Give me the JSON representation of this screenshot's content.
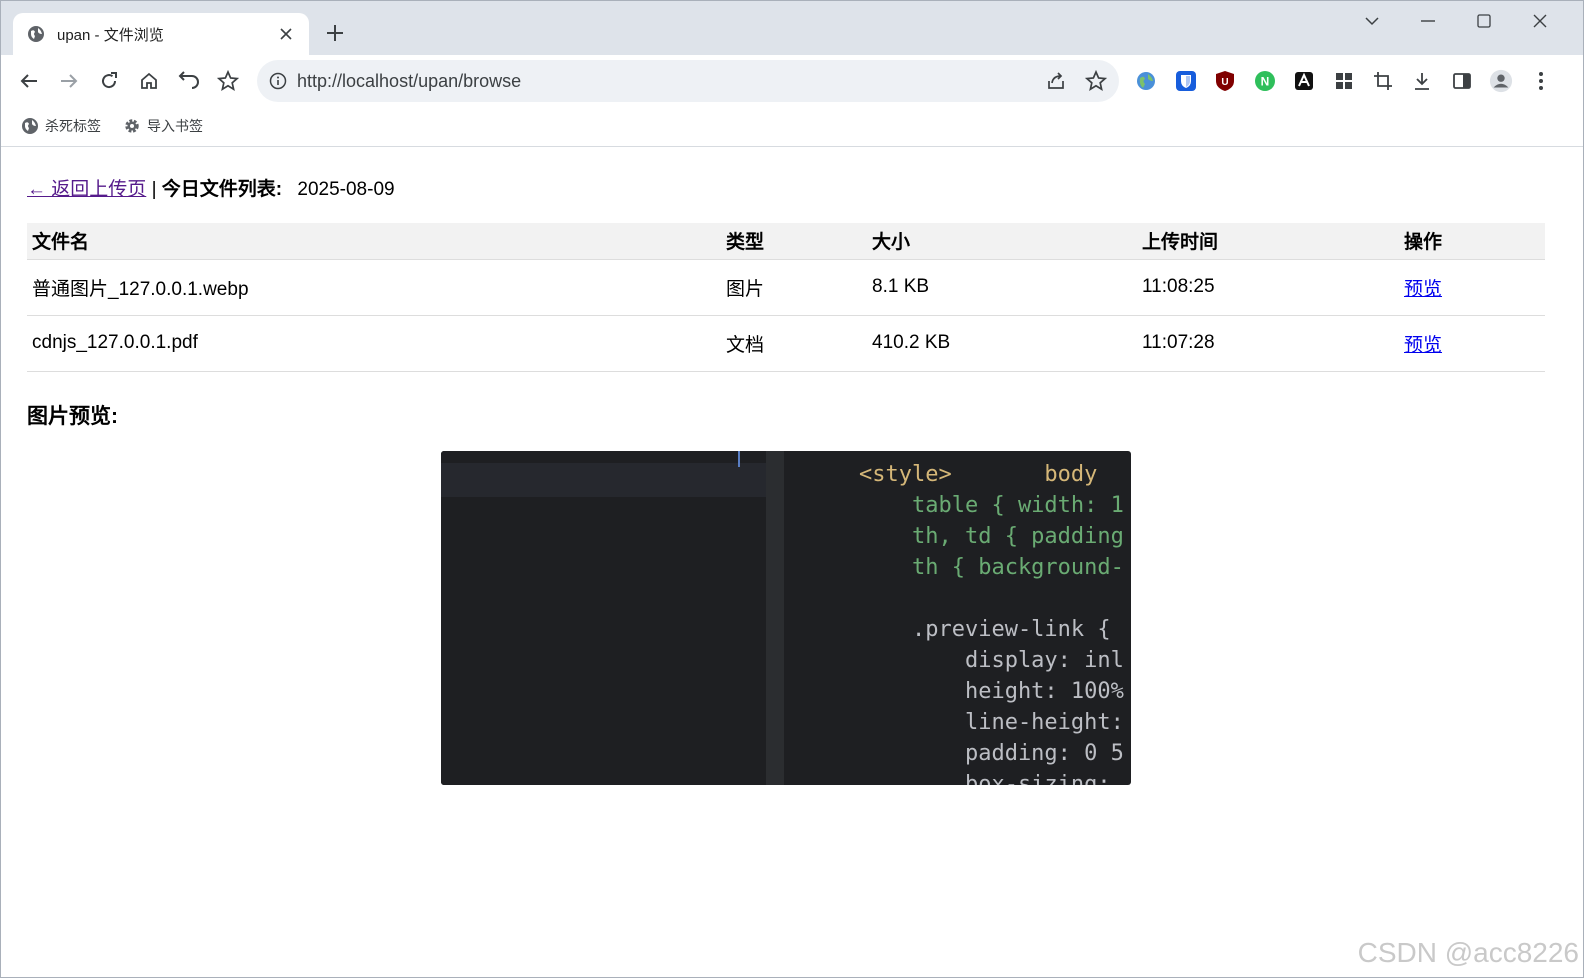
{
  "browser": {
    "tab_title": "upan - 文件浏览",
    "url": "http://localhost/upan/browse",
    "bookmarks": [
      {
        "label": "杀死标签",
        "icon": "globe-icon"
      },
      {
        "label": "导入书签",
        "icon": "gear-icon"
      }
    ],
    "extensions": [
      "globe-extension-icon",
      "bitwarden-icon",
      "ublock-icon",
      "n-extension-icon",
      "a-extension-icon",
      "extensions-grid-icon",
      "crop-icon",
      "download-icon",
      "side-panel-icon",
      "profile-icon",
      "menu-icon"
    ]
  },
  "page": {
    "back_link": "← 返回上传页",
    "separator": "|",
    "list_label": "今日文件列表:",
    "date": "2025-08-09",
    "table": {
      "headers": [
        "文件名",
        "类型",
        "大小",
        "上传时间",
        "操作"
      ],
      "rows": [
        {
          "name": "普通图片_127.0.0.1.webp",
          "type": "图片",
          "size": "8.1 KB",
          "time": "11:08:25",
          "action": "预览"
        },
        {
          "name": "cdnjs_127.0.0.1.pdf",
          "type": "文档",
          "size": "410.2 KB",
          "time": "11:07:28",
          "action": "预览"
        }
      ]
    },
    "preview_title": "图片预览:",
    "preview_code_lines": [
      "<style>       body",
      "    table { width: 1",
      "    th, td { padding",
      "    th { background-",
      "",
      "    .preview-link {",
      "        display: inl",
      "        height: 100%",
      "        line-height:",
      "        padding: 0 5",
      "        box-sizing:"
    ]
  },
  "watermark": "CSDN @acc8226"
}
